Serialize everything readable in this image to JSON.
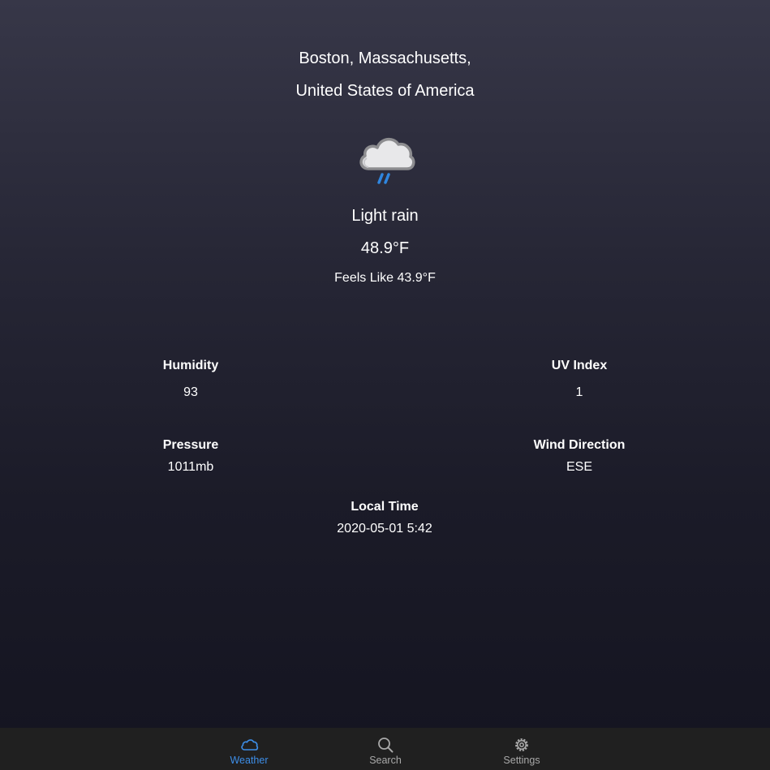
{
  "location": {
    "line1": "Boston, Massachusetts,",
    "line2": "United States of America"
  },
  "current": {
    "icon": "cloud-rain-icon",
    "condition": "Light rain",
    "temperature": "48.9°F",
    "feels_like_label": "Feels Like",
    "feels_like_value": "43.9°F"
  },
  "stats": {
    "humidity": {
      "label": "Humidity",
      "value": "93"
    },
    "uv_index": {
      "label": "UV Index",
      "value": "1"
    },
    "pressure": {
      "label": "Pressure",
      "value": "1011mb"
    },
    "wind_direction": {
      "label": "Wind Direction",
      "value": "ESE"
    },
    "local_time": {
      "label": "Local Time",
      "value": "2020-05-01 5:42"
    }
  },
  "tabs": [
    {
      "label": "Weather",
      "icon": "cloud-icon",
      "active": true
    },
    {
      "label": "Search",
      "icon": "search-icon",
      "active": false
    },
    {
      "label": "Settings",
      "icon": "gear-icon",
      "active": false
    }
  ],
  "colors": {
    "accent": "#3d8ee8",
    "tab_inactive": "#a9a9a9",
    "tabbar_bg": "#202020"
  }
}
